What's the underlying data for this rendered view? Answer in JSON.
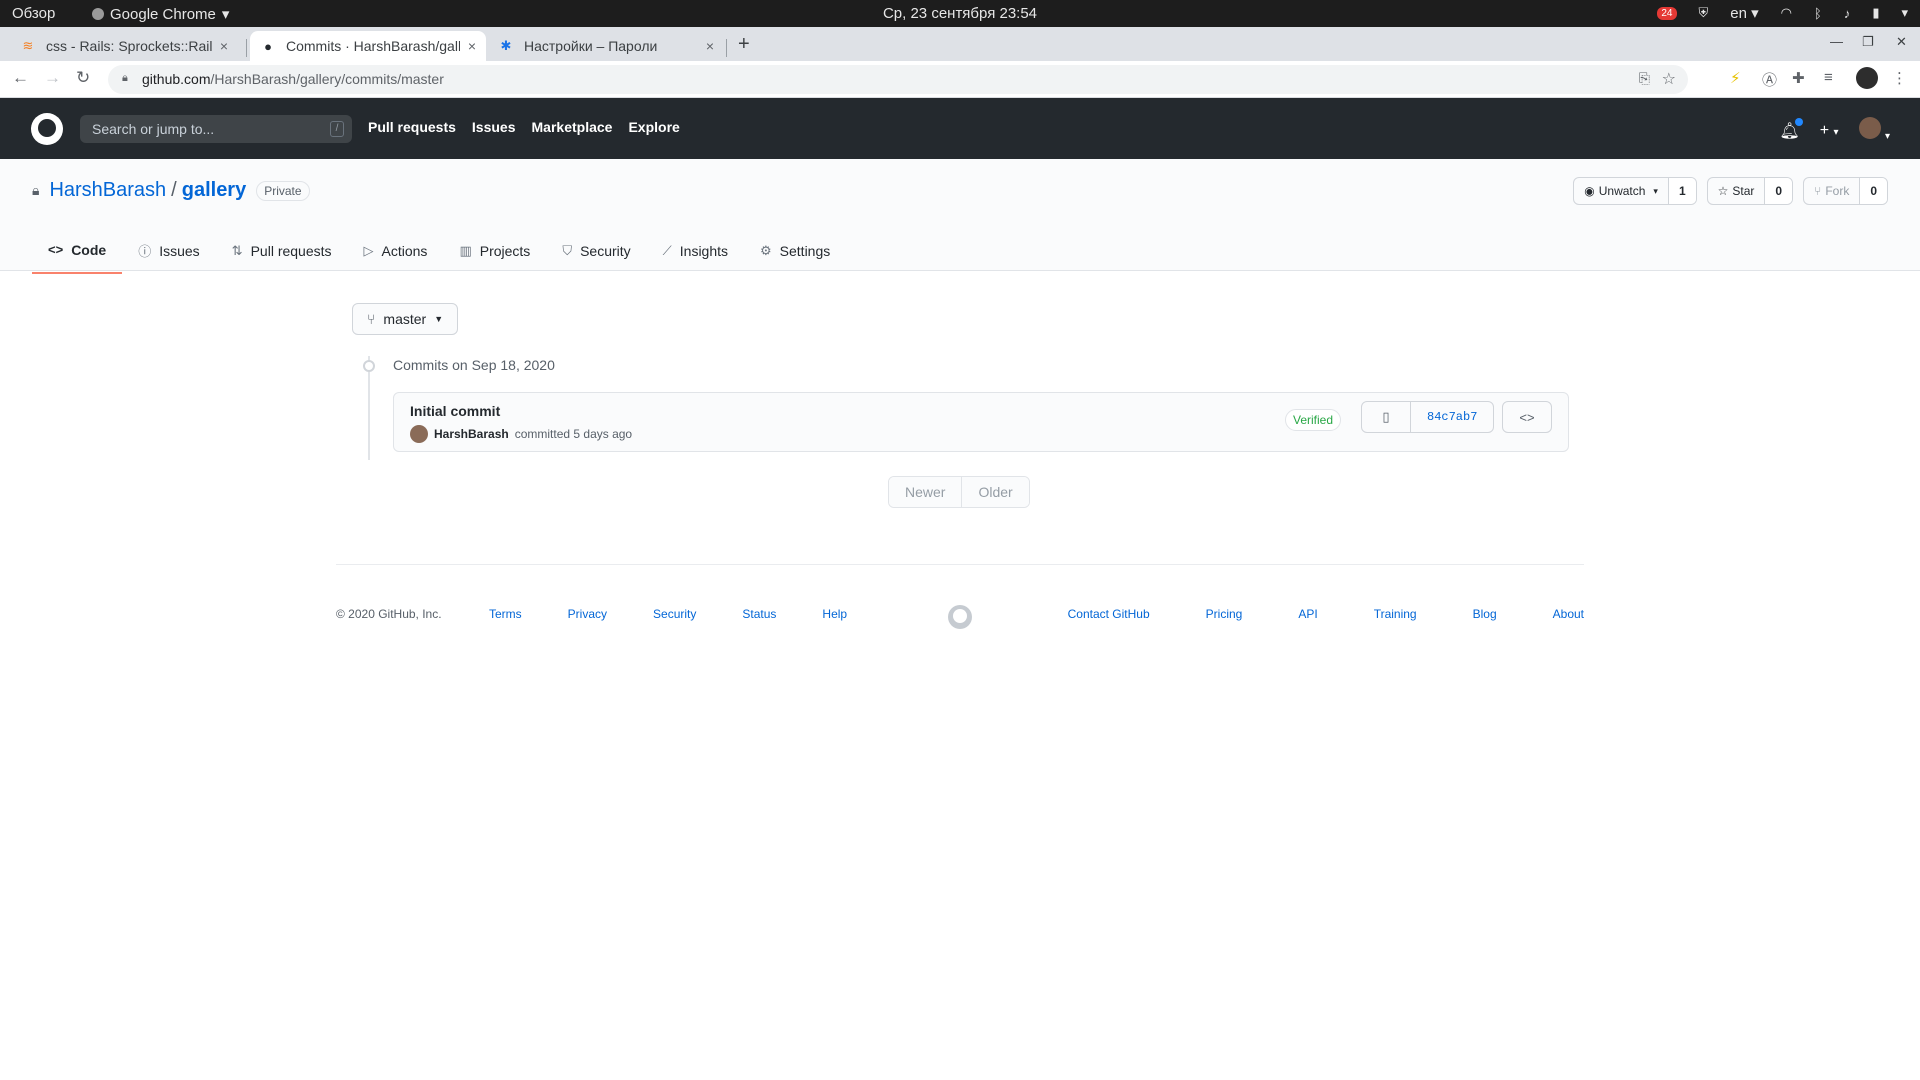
{
  "os": {
    "overview": "Обзор",
    "app_name": "Google Chrome",
    "clock": "Ср, 23 сентября  23:54",
    "notif_count": "24",
    "lang": "en"
  },
  "tabs": [
    {
      "title": "css - Rails: Sprockets::Rails",
      "close": "×"
    },
    {
      "title": "Commits · HarshBarash/gallery",
      "close": "×"
    },
    {
      "title": "Настройки – Пароли",
      "close": "×"
    }
  ],
  "toolbar": {
    "url_host": "github.com",
    "url_path": "/HarshBarash/gallery/commits/master"
  },
  "gh_header": {
    "search_placeholder": "Search or jump to...",
    "slash": "/",
    "nav": [
      "Pull requests",
      "Issues",
      "Marketplace",
      "Explore"
    ]
  },
  "repo": {
    "owner": "HarshBarash",
    "separator": "/",
    "name": "gallery",
    "visibility": "Private",
    "watch_label": "Unwatch",
    "watch_count": "1",
    "star_label": "Star",
    "star_count": "0",
    "fork_label": "Fork",
    "fork_count": "0",
    "tabs": [
      "Code",
      "Issues",
      "Pull requests",
      "Actions",
      "Projects",
      "Security",
      "Insights",
      "Settings"
    ]
  },
  "main": {
    "branch": "master",
    "commits_date": "Commits on Sep 18, 2020",
    "commit": {
      "message": "Initial commit",
      "author": "HarshBarash",
      "meta": "committed 5 days ago",
      "verified": "Verified",
      "sha": "84c7ab7"
    },
    "pager": {
      "newer": "Newer",
      "older": "Older"
    }
  },
  "footer": {
    "copyright": "© 2020 GitHub, Inc.",
    "left_links": [
      "Terms",
      "Privacy",
      "Security",
      "Status",
      "Help"
    ],
    "right_links": [
      "Contact GitHub",
      "Pricing",
      "API",
      "Training",
      "Blog",
      "About"
    ]
  },
  "colors": {
    "gh_header_bg": "#24292e",
    "link": "#0366d6",
    "active_tab_underline": "#f9826c",
    "verified": "#28a745"
  }
}
